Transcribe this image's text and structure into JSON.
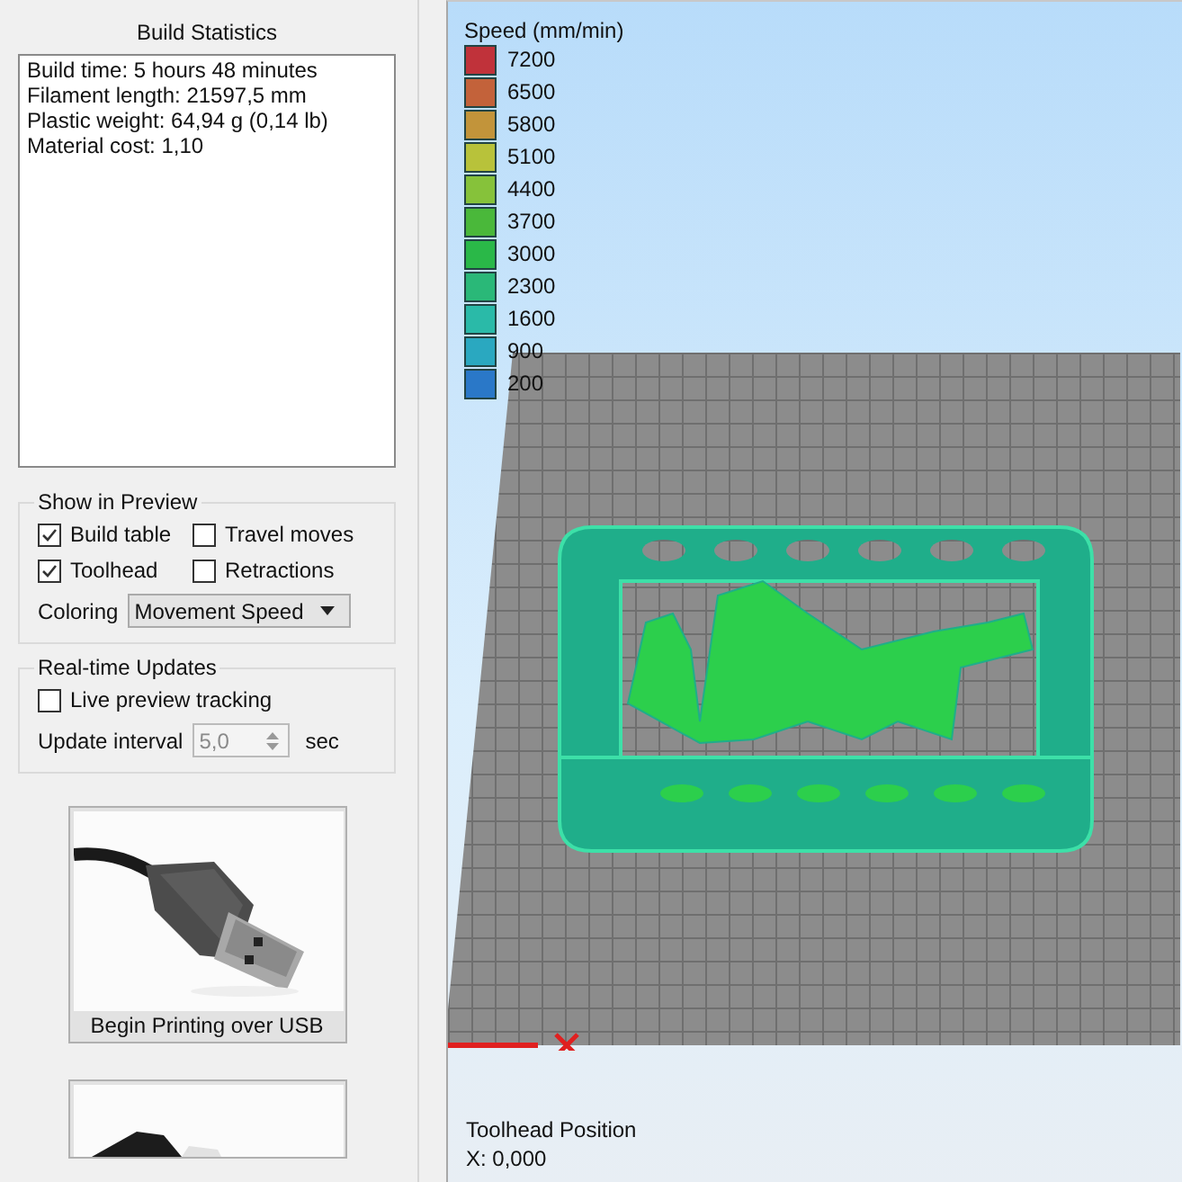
{
  "build_statistics": {
    "title": "Build Statistics",
    "lines": [
      "Build time: 5 hours 48 minutes",
      "Filament length: 21597,5 mm",
      "Plastic weight: 64,94 g (0,14 lb)",
      "Material cost: 1,10"
    ]
  },
  "show_in_preview": {
    "title": "Show in Preview",
    "options": [
      {
        "label": "Build table",
        "checked": true
      },
      {
        "label": "Travel moves",
        "checked": false
      },
      {
        "label": "Toolhead",
        "checked": true
      },
      {
        "label": "Retractions",
        "checked": false
      }
    ],
    "coloring": {
      "label": "Coloring",
      "value": "Movement Speed"
    }
  },
  "realtime_updates": {
    "title": "Real-time Updates",
    "live_tracking": {
      "label": "Live preview tracking",
      "checked": false
    },
    "update_interval": {
      "label": "Update interval",
      "value": "5,0",
      "disabled": true,
      "unit": "sec"
    }
  },
  "print_buttons": [
    {
      "kind": "usb",
      "label": "Begin Printing over USB"
    },
    {
      "kind": "card"
    }
  ],
  "viewport": {
    "legend": {
      "title": "Speed (mm/min)",
      "items": [
        {
          "label": "7200",
          "color": "#c0323a"
        },
        {
          "label": "6500",
          "color": "#c3623a"
        },
        {
          "label": "5800",
          "color": "#c2943a"
        },
        {
          "label": "5100",
          "color": "#b8c23a"
        },
        {
          "label": "4400",
          "color": "#86c23a"
        },
        {
          "label": "3700",
          "color": "#4ab83a"
        },
        {
          "label": "3000",
          "color": "#2ab848"
        },
        {
          "label": "2300",
          "color": "#2ab878"
        },
        {
          "label": "1600",
          "color": "#2abaa8"
        },
        {
          "label": "900",
          "color": "#2aa8c0"
        },
        {
          "label": "200",
          "color": "#2a78c8"
        }
      ]
    },
    "toolhead_position": {
      "title": "Toolhead Position",
      "x": "X: 0,000"
    }
  }
}
